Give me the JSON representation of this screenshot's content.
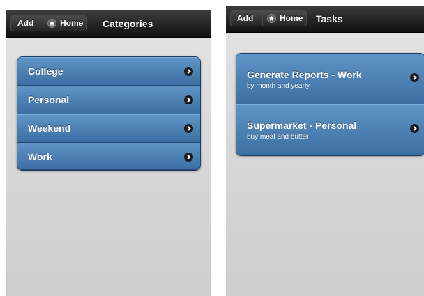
{
  "left": {
    "header": {
      "add_label": "Add",
      "home_label": "Home",
      "title": "Categories"
    },
    "items": [
      {
        "label": "College"
      },
      {
        "label": "Personal"
      },
      {
        "label": "Weekend"
      },
      {
        "label": "Work"
      }
    ]
  },
  "right": {
    "header": {
      "add_label": "Add",
      "home_label": "Home",
      "title": "Tasks"
    },
    "items": [
      {
        "label": "Generate Reports - Work",
        "sublabel": "by month and yearly"
      },
      {
        "label": "Supermarket - Personal",
        "sublabel": "buy meal and butter"
      }
    ]
  },
  "icons": {
    "home": "home-icon",
    "chevron": "chevron-right-icon"
  },
  "colors": {
    "header": "#1a1a1a",
    "list_item": "#4a7fb5",
    "background": "#d8d8d8"
  }
}
